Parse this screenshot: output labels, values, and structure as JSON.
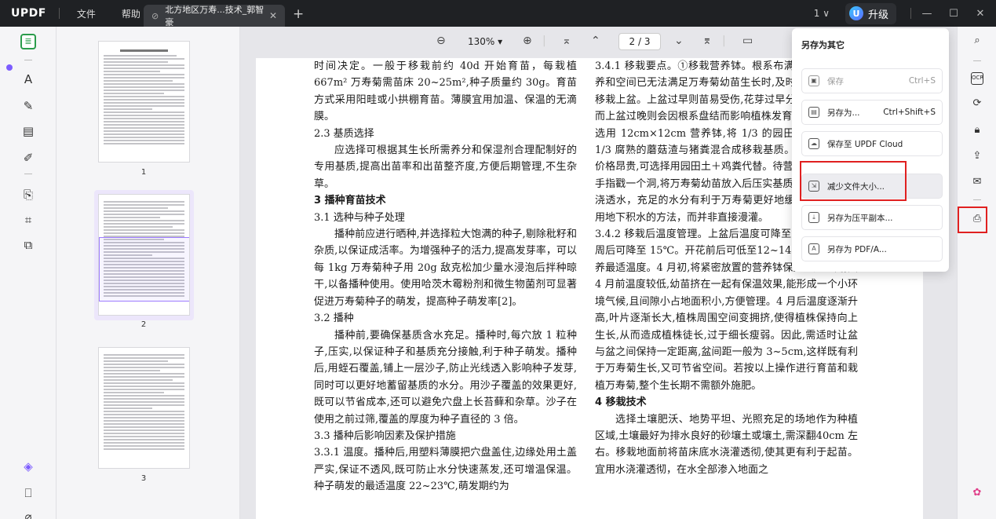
{
  "titlebar": {
    "logo": "UPDF",
    "menu_file": "文件",
    "menu_help": "帮助",
    "tab_title": "北方地区万寿...技术_郭智豪",
    "page_count": "1",
    "upgrade_label": "升级",
    "avatar_letter": "U"
  },
  "toolbar": {
    "zoom": "130%",
    "page_indicator": "2 / 3"
  },
  "thumbnails": [
    {
      "label": "1"
    },
    {
      "label": "2"
    },
    {
      "label": "3"
    }
  ],
  "document": {
    "col1": [
      {
        "t": "时间决定。一般于移栽前约 40d 开始育苗，每栽植667m² 万寿菊需苗床 20~25m²,种子质量约 30g。育苗方式采用阳畦或小拱棚育苗。薄膜宜用加温、保温的无滴膜。",
        "c": ""
      },
      {
        "t": "2.3  基质选择",
        "c": ""
      },
      {
        "t": "应选择可根据其生长所需养分和保湿剂合理配制好的专用基质,提高出苗率和出苗整齐度,方便后期管理,不生杂草。",
        "c": "ind"
      },
      {
        "t": "3   播种育苗技术",
        "c": "h3"
      },
      {
        "t": "3.1  选种与种子处理",
        "c": ""
      },
      {
        "t": "播种前应进行晒种,并选择粒大饱满的种子,剔除秕籽和杂质,以保证成活率。为增强种子的活力,提高发芽率，可以每 1kg 万寿菊种子用 20g 敌克松加少量水浸泡后拌种晾干,以备播种使用。使用哈茨木霉粉剂和微生物菌剂可显著促进万寿菊种子的萌发，提高种子萌发率[2]。",
        "c": "ind"
      },
      {
        "t": "3.2  播种",
        "c": ""
      },
      {
        "t": "播种前,要确保基质含水充足。播种时,每穴放 1 粒种子,压实,以保证种子和基质充分接触,利于种子萌发。播种后,用蛭石覆盖,铺上一层沙子,防止光线透入影响种子发芽,同时可以更好地蓄留基质的水分。用沙子覆盖的效果更好,既可以节省成本,还可以避免穴盘上长苔藓和杂草。沙子在使用之前过筛,覆盖的厚度为种子直径的 3 倍。",
        "c": "ind"
      },
      {
        "t": "3.3  播种后影响因素及保护措施",
        "c": ""
      },
      {
        "t": "3.3.1  温度。播种后,用塑料薄膜把穴盘盖住,边缘处用土盖严实,保证不透风,既可防止水分快速蒸发,还可增温保温。种子萌发的最适温度 22~23℃,萌发期约为",
        "c": ""
      }
    ],
    "col2": [
      {
        "t": "3.4.1  移栽要点。①移栽营养钵。根系布满穴盘里面的营养和空间已无法满足万寿菊幼苗生长时,及时将万寿菊幼苗移栽上盆。上盆过早则苗易受伤,花芽过早分化即养老苗，而上盆过晚则会因根系盘结而影响植株发育。移栽上盆时,选用 12cm×12cm 营养钵,将 1/3 的园田土、1/3 沙和 1/3 腐熟的蘑菇渣与猪粪混合成移栽基质。因蘑菇肥菌袋价格昂贵,可选择用园田土＋鸡粪代替。待营养钵装满后,用手指戳一个洞,将万寿菊幼苗放入后压实基质即可,上盆后需浇透水，充足的水分有利于万寿菊更好地缓苗。浇水可采用地下积水的方法，而并非直接漫灌。",
        "c": ""
      },
      {
        "t": "3.4.2  移栽后温度管理。上盆后温度可降至18℃，经过几周后可降至 15℃。开花前后可低至12~14℃,此为株型培养最适温度。4 月初,将紧密放置的营养钵保持一定距离,因 4 月前温度较低,幼苗挤在一起有保温效果,能形成一个小环境气候,且间隙小占地面积小,方便管理。4 月后温度逐渐升高,叶片逐渐长大,植株周围空间变拥挤,使得植株保持向上生长,从而造成植株徒长,过于细长瘦弱。因此,需适时让盆与盆之间保持一定距离,盆间距一般为 3~5cm,这样既有利于万寿菊生长,又可节省空间。若按以上操作进行育苗和栽植万寿菊,整个生长期不需额外施肥。",
        "c": ""
      },
      {
        "t": "4   移栽技术",
        "c": "h3"
      },
      {
        "t": "选择土壤肥沃、地势平坦、光照充足的场地作为种植区域,土壤最好为排水良好的砂壤土或壤土,需深翻40cm 左右。移栽地面前将苗床底水浇灌透彻,使其更有利于起苗。宜用水浇灌透彻，在水全部渗入地面之",
        "c": "ind"
      }
    ]
  },
  "save_menu": {
    "title": "另存为其它",
    "items": [
      {
        "label": "保存",
        "shortcut": "Ctrl+S",
        "icon": "save-icon",
        "disabled": true
      },
      {
        "label": "另存为...",
        "shortcut": "Ctrl+Shift+S",
        "icon": "save-as-icon",
        "disabled": false
      },
      {
        "label": "保存至 UPDF Cloud",
        "shortcut": "",
        "icon": "cloud-icon",
        "disabled": false
      },
      {
        "label": "减少文件大小...",
        "shortcut": "",
        "icon": "compress-icon",
        "disabled": false
      },
      {
        "label": "另存为压平副本...",
        "shortcut": "",
        "icon": "flatten-icon",
        "disabled": false
      },
      {
        "label": "另存为 PDF/A...",
        "shortcut": "",
        "icon": "pdfa-icon",
        "disabled": false
      }
    ]
  },
  "colors": {
    "accent_green": "#2b9c4b",
    "accent_purple": "#9d7bff",
    "highlight_red": "#e02020"
  }
}
